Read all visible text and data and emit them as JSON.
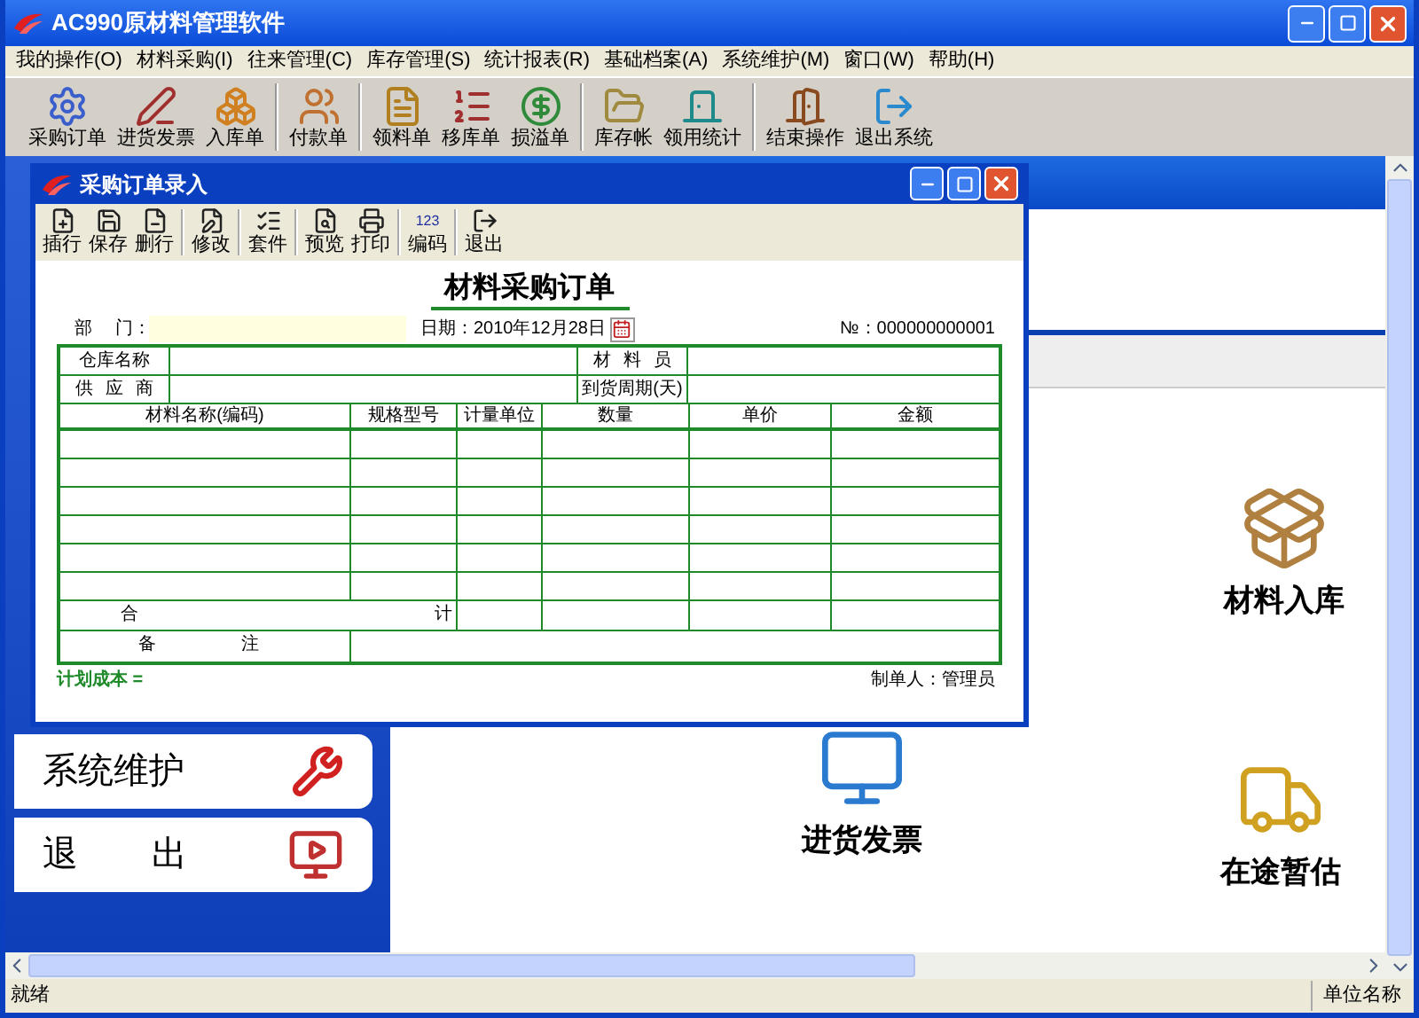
{
  "window": {
    "title": "AC990原材料管理软件"
  },
  "menu": [
    {
      "label": "我的操作(O)"
    },
    {
      "label": "材料采购(I)"
    },
    {
      "label": "往来管理(C)"
    },
    {
      "label": "库存管理(S)"
    },
    {
      "label": "统计报表(R)"
    },
    {
      "label": "基础档案(A)"
    },
    {
      "label": "系统维护(M)"
    },
    {
      "label": "窗口(W)"
    },
    {
      "label": "帮助(H)"
    }
  ],
  "toolbar": [
    [
      {
        "label": "采购订单"
      },
      {
        "label": "进货发票"
      },
      {
        "label": "入库单"
      }
    ],
    [
      {
        "label": "付款单"
      }
    ],
    [
      {
        "label": "领料单"
      },
      {
        "label": "移库单"
      },
      {
        "label": "损溢单"
      }
    ],
    [
      {
        "label": "库存帐"
      },
      {
        "label": "领用统计"
      }
    ],
    [
      {
        "label": "结束操作"
      },
      {
        "label": "退出系统"
      }
    ]
  ],
  "sidebar": {
    "items": [
      {
        "label": "系统维护"
      },
      {
        "label": "退 出"
      }
    ]
  },
  "shortcuts": [
    {
      "label": "材料入库"
    },
    {
      "label": "进货发票"
    },
    {
      "label": "在途暂估"
    }
  ],
  "child_window": {
    "title": "采购订单录入",
    "toolbar": [
      [
        {
          "label": "插行"
        },
        {
          "label": "保存"
        },
        {
          "label": "删行"
        }
      ],
      [
        {
          "label": "修改"
        }
      ],
      [
        {
          "label": "套件"
        }
      ],
      [
        {
          "label": "预览"
        },
        {
          "label": "打印"
        }
      ],
      [
        {
          "label": "编码",
          "icon_text": "123"
        }
      ],
      [
        {
          "label": "退出"
        }
      ]
    ],
    "form": {
      "title": "材料采购订单",
      "department_label": "部 门：",
      "date": "日期：2010年12月28日",
      "number": "№：000000000001",
      "header_rows": [
        [
          "仓库名称",
          "材 料 员"
        ],
        [
          "供 应 商",
          "到货周期(天)"
        ]
      ],
      "columns": [
        "材料名称(编码)",
        "规格型号",
        "计量单位",
        "数量",
        "单价",
        "金额"
      ],
      "total_label": [
        "合",
        "计"
      ],
      "remark_label": [
        "备",
        "注"
      ],
      "plan_cost": "计划成本 =",
      "maker": "制单人：管理员"
    }
  },
  "status_bar": {
    "left": "就绪",
    "right": "单位名称"
  }
}
